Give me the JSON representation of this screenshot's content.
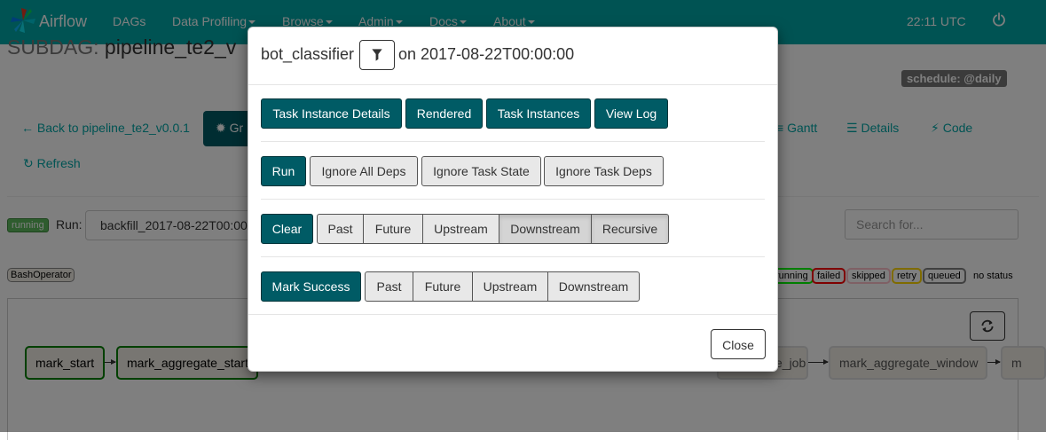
{
  "navbar": {
    "brand": "Airflow",
    "items": [
      {
        "label": "DAGs",
        "dropdown": false
      },
      {
        "label": "Data Profiling",
        "dropdown": true
      },
      {
        "label": "Browse",
        "dropdown": true
      },
      {
        "label": "Admin",
        "dropdown": true
      },
      {
        "label": "Docs",
        "dropdown": true
      },
      {
        "label": "About",
        "dropdown": true
      }
    ],
    "time": "22:11 UTC",
    "color": "#00a7a7"
  },
  "page": {
    "title_prefix": "SUBDAG: ",
    "title_name": "pipeline_te2_v",
    "schedule": "schedule: @daily",
    "back_link": "Back to pipeline_te2_v0.0.1",
    "graph_tab": "Gr",
    "tabs": {
      "gantt": "Gantt",
      "details": "Details",
      "code": "Code"
    },
    "refresh": "Refresh",
    "run_state": "running",
    "run_label": "Run:",
    "run_value": "backfill_2017-08-22T00:00",
    "search_placeholder": "Search for...",
    "operator": "BashOperator",
    "legend": [
      {
        "label": "running",
        "color": "#00ff00"
      },
      {
        "label": "failed",
        "color": "#ff0000"
      },
      {
        "label": "skipped",
        "color": "#ffc0cb"
      },
      {
        "label": "retry",
        "color": "#ffd700"
      },
      {
        "label": "queued",
        "color": "#808080"
      },
      {
        "label": "no status",
        "color": "#ffffff"
      }
    ],
    "nodes": [
      {
        "label": "mark_start",
        "state": "success"
      },
      {
        "label": "mark_aggregate_start",
        "state": "success"
      },
      {
        "label": "e_job",
        "state": "faded"
      },
      {
        "label": "mark_aggregate_window",
        "state": "faded"
      },
      {
        "label": "m",
        "state": "faded"
      }
    ]
  },
  "modal": {
    "task": "bot_classifier",
    "on_date": "on 2017-08-22T00:00:00",
    "row1": [
      "Task Instance Details",
      "Rendered",
      "Task Instances",
      "View Log"
    ],
    "run": {
      "action": "Run",
      "options": [
        {
          "label": "Ignore All Deps",
          "active": false
        },
        {
          "label": "Ignore Task State",
          "active": false
        },
        {
          "label": "Ignore Task Deps",
          "active": false
        }
      ]
    },
    "clear": {
      "action": "Clear",
      "options": [
        {
          "label": "Past",
          "active": false
        },
        {
          "label": "Future",
          "active": false
        },
        {
          "label": "Upstream",
          "active": false
        },
        {
          "label": "Downstream",
          "active": true
        },
        {
          "label": "Recursive",
          "active": true
        }
      ]
    },
    "mark_success": {
      "action": "Mark Success",
      "options": [
        {
          "label": "Past",
          "active": false
        },
        {
          "label": "Future",
          "active": false
        },
        {
          "label": "Upstream",
          "active": false
        },
        {
          "label": "Downstream",
          "active": false
        }
      ]
    },
    "close": "Close"
  }
}
